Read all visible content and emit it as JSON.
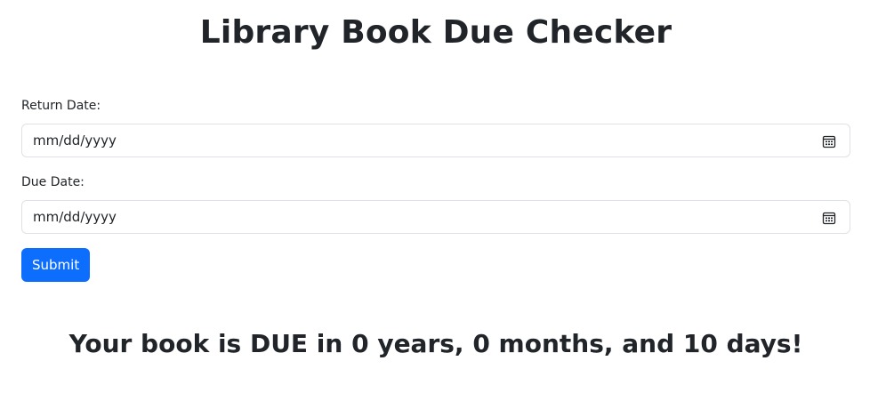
{
  "header": {
    "title": "Library Book Due Checker"
  },
  "form": {
    "return_date": {
      "label": "Return Date:",
      "placeholder": "mm/dd/yyyy",
      "value": ""
    },
    "due_date": {
      "label": "Due Date:",
      "placeholder": "mm/dd/yyyy",
      "value": ""
    },
    "submit_label": "Submit"
  },
  "result": {
    "message": "Your book is DUE in 0 years, 0 months, and 10 days!"
  },
  "icons": {
    "date_picker": "calendar-icon"
  },
  "colors": {
    "primary": "#0d6efd",
    "text": "#212529",
    "border": "#dee2e6"
  }
}
